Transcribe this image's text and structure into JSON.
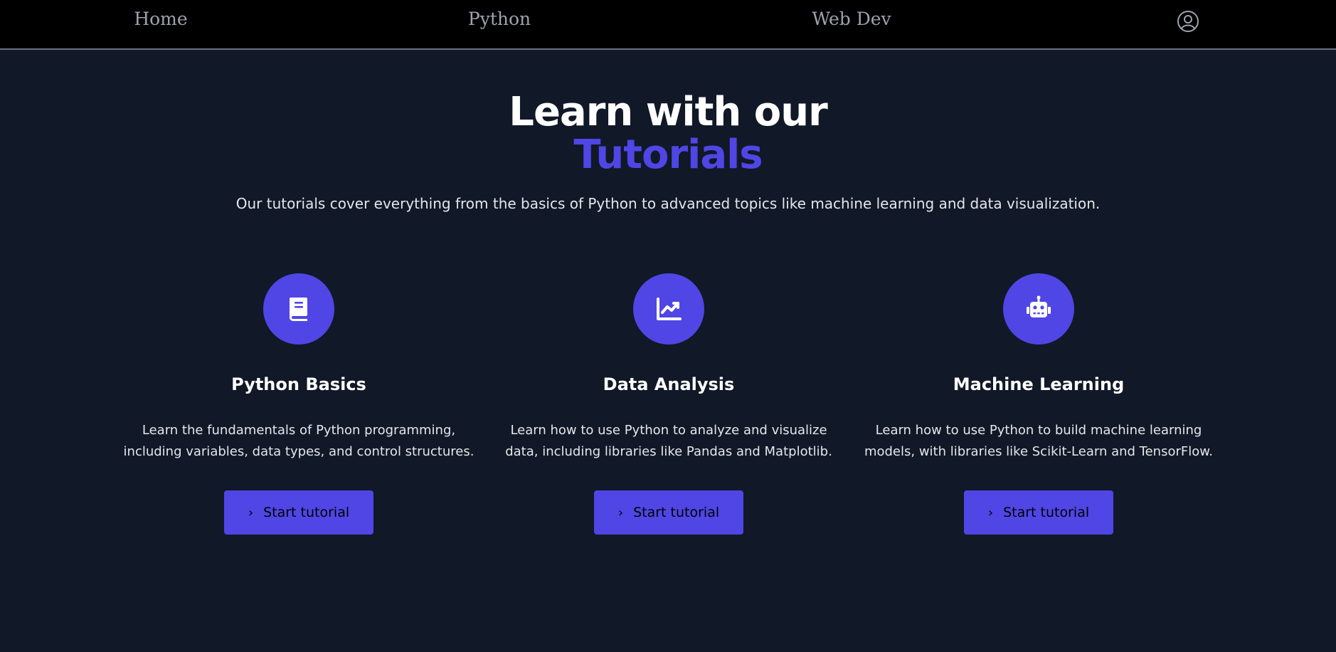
{
  "nav": {
    "home": "Home",
    "python": "Python",
    "webdev": "Web Dev",
    "account_icon": "user-circle-icon"
  },
  "hero": {
    "title_line1": "Learn with our",
    "title_line2": "Tutorials",
    "subtitle": "Our tutorials cover everything from the basics of Python to advanced topics like machine learning and data visualization."
  },
  "cards": [
    {
      "icon": "book-icon",
      "title": "Python Basics",
      "desc_line1": "Learn the fundamentals of Python programming,",
      "desc_line2": "including variables, data types, and control structures.",
      "button": "Start tutorial"
    },
    {
      "icon": "chart-line-icon",
      "title": "Data Analysis",
      "desc_line1": "Learn how to use Python to analyze and visualize",
      "desc_line2": "data, including libraries like Pandas and Matplotlib.",
      "button": "Start tutorial"
    },
    {
      "icon": "robot-icon",
      "title": "Machine Learning",
      "desc_line1": "Learn how to use Python to build machine learning",
      "desc_line2": "models, with libraries like Scikit-Learn and TensorFlow.",
      "button": "Start tutorial"
    }
  ],
  "colors": {
    "background": "#111827",
    "nav_background": "#000000",
    "accent": "#4f46e5",
    "nav_text": "#9ca3af",
    "text": "#e5e7eb"
  }
}
